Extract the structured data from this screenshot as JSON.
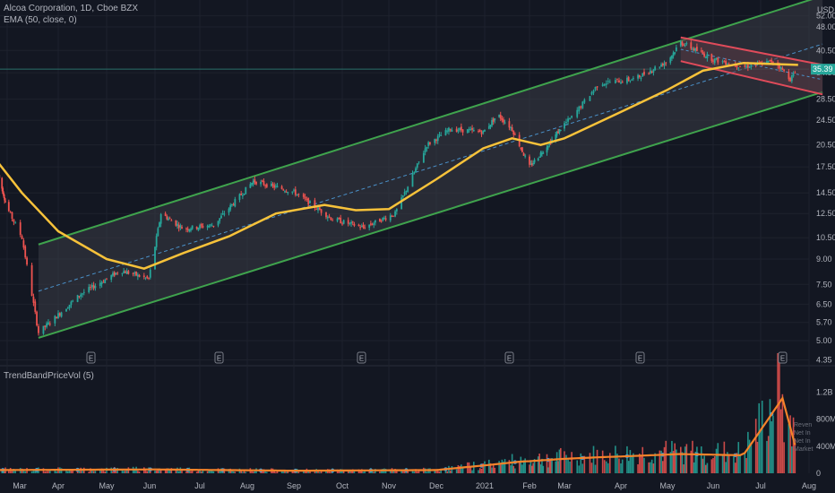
{
  "header": {
    "symbol_line": "Alcoa Corporation, 1D, Cboe BZX",
    "indicator_line": "EMA (50, close, 0)",
    "currency": "USD"
  },
  "lower_pane": {
    "title": "TrendBandPriceVol (5)",
    "right_labels": [
      "Reven",
      "Net In",
      "Net In",
      "Market"
    ]
  },
  "colors": {
    "background": "#131722",
    "grid": "#1e222d",
    "up": "#26a69a",
    "down": "#ef5350",
    "ema": "#f7c23a",
    "channel_edge": "#3fa34d",
    "channel_fill": "#3a3d46",
    "flag_edge": "#e04b5a",
    "midline": "#4a90c8",
    "axis_text": "#b2b5be",
    "volume_line": "#f5832a",
    "volume_marker": "#3a9ad9"
  },
  "chart_data": [
    {
      "type": "candlestick",
      "price_axis_labels": [
        "52.00",
        "48.00",
        "40.50",
        "34.50",
        "28.50",
        "24.50",
        "20.50",
        "17.50",
        "14.50",
        "12.50",
        "10.50",
        "9.00",
        "7.50",
        "6.50",
        "5.70",
        "5.00",
        "4.35"
      ],
      "price_axis_values": [
        52,
        48,
        40.5,
        34.5,
        28.5,
        24.5,
        20.5,
        17.5,
        14.5,
        12.5,
        10.5,
        9,
        7.5,
        6.5,
        5.7,
        5,
        4.35
      ],
      "scale": "log",
      "time_axis_labels": [
        "Mar",
        "Apr",
        "May",
        "Jun",
        "Jul",
        "Aug",
        "Sep",
        "Oct",
        "Nov",
        "Dec",
        "2021",
        "Feb",
        "Mar",
        "Apr",
        "May",
        "Jun",
        "Jul",
        "Aug"
      ],
      "last_price": "35.39",
      "earnings_markers": [
        "E",
        "E",
        "E",
        "E",
        "E",
        "E"
      ],
      "key_prices": [
        {
          "date": "2020-02-20",
          "price": 16.5
        },
        {
          "date": "2020-03-10",
          "price": 10.5
        },
        {
          "date": "2020-03-20",
          "price": 5.3
        },
        {
          "date": "2020-04-15",
          "price": 7.0
        },
        {
          "date": "2020-05-10",
          "price": 8.3
        },
        {
          "date": "2020-05-28",
          "price": 7.8
        },
        {
          "date": "2020-06-05",
          "price": 12.5
        },
        {
          "date": "2020-06-20",
          "price": 11.2
        },
        {
          "date": "2020-07-10",
          "price": 11.5
        },
        {
          "date": "2020-08-05",
          "price": 15.8
        },
        {
          "date": "2020-09-01",
          "price": 14.6
        },
        {
          "date": "2020-09-25",
          "price": 12.0
        },
        {
          "date": "2020-10-15",
          "price": 11.3
        },
        {
          "date": "2020-11-05",
          "price": 12.5
        },
        {
          "date": "2020-11-25",
          "price": 20.5
        },
        {
          "date": "2020-12-10",
          "price": 23.0
        },
        {
          "date": "2020-12-31",
          "price": 22.5
        },
        {
          "date": "2021-01-10",
          "price": 25.5
        },
        {
          "date": "2021-01-20",
          "price": 23.0
        },
        {
          "date": "2021-02-01",
          "price": 17.5
        },
        {
          "date": "2021-02-20",
          "price": 21.5
        },
        {
          "date": "2021-03-05",
          "price": 25.0
        },
        {
          "date": "2021-03-20",
          "price": 32.0
        },
        {
          "date": "2021-04-10",
          "price": 33.0
        },
        {
          "date": "2021-05-01",
          "price": 37.5
        },
        {
          "date": "2021-05-10",
          "price": 43.0
        },
        {
          "date": "2021-06-01",
          "price": 38.0
        },
        {
          "date": "2021-06-20",
          "price": 36.0
        },
        {
          "date": "2021-07-10",
          "price": 37.5
        },
        {
          "date": "2021-07-20",
          "price": 33.0
        },
        {
          "date": "2021-07-25",
          "price": 35.39
        }
      ],
      "ema_50": [
        {
          "date": "2020-02-20",
          "value": 18.0
        },
        {
          "date": "2020-03-10",
          "value": 14.5
        },
        {
          "date": "2020-04-01",
          "value": 11.0
        },
        {
          "date": "2020-05-01",
          "value": 9.0
        },
        {
          "date": "2020-05-25",
          "value": 8.4
        },
        {
          "date": "2020-06-20",
          "value": 9.4
        },
        {
          "date": "2020-07-20",
          "value": 10.6
        },
        {
          "date": "2020-08-20",
          "value": 12.5
        },
        {
          "date": "2020-09-20",
          "value": 13.3
        },
        {
          "date": "2020-10-10",
          "value": 12.8
        },
        {
          "date": "2020-11-01",
          "value": 12.9
        },
        {
          "date": "2020-12-01",
          "value": 16.0
        },
        {
          "date": "2020-12-31",
          "value": 20.0
        },
        {
          "date": "2021-01-20",
          "value": 21.5
        },
        {
          "date": "2021-02-10",
          "value": 20.5
        },
        {
          "date": "2021-03-01",
          "value": 21.5
        },
        {
          "date": "2021-04-01",
          "value": 26.0
        },
        {
          "date": "2021-05-01",
          "value": 30.5
        },
        {
          "date": "2021-05-25",
          "value": 35.0
        },
        {
          "date": "2021-06-20",
          "value": 37.0
        },
        {
          "date": "2021-07-25",
          "value": 36.5
        }
      ],
      "ascending_channel": {
        "upper": [
          {
            "date": "2020-03-20",
            "price": 10.0
          },
          {
            "date": "2021-08-10",
            "price": 60.0
          }
        ],
        "lower": [
          {
            "date": "2020-03-20",
            "price": 5.1
          },
          {
            "date": "2021-08-10",
            "price": 30.0
          }
        ]
      },
      "descending_flag": {
        "upper": [
          {
            "date": "2021-05-10",
            "price": 44.5
          },
          {
            "date": "2021-08-10",
            "price": 36.5
          }
        ],
        "lower": [
          {
            "date": "2021-05-10",
            "price": 37.5
          },
          {
            "date": "2021-08-10",
            "price": 29.5
          }
        ]
      }
    },
    {
      "type": "bar",
      "name": "volume",
      "axis_labels": [
        "1.2B",
        "800M",
        "400M",
        "0"
      ],
      "axis_values": [
        1200,
        800,
        400,
        0
      ],
      "units": "M",
      "key_volumes": [
        {
          "date": "2020-02-20",
          "value": 50
        },
        {
          "date": "2020-06-01",
          "value": 60
        },
        {
          "date": "2020-09-01",
          "value": 40
        },
        {
          "date": "2020-12-01",
          "value": 50
        },
        {
          "date": "2021-01-25",
          "value": 180
        },
        {
          "date": "2021-03-20",
          "value": 250
        },
        {
          "date": "2021-05-10",
          "value": 300
        },
        {
          "date": "2021-06-20",
          "value": 280
        },
        {
          "date": "2021-07-15",
          "value": 1170
        },
        {
          "date": "2021-07-25",
          "value": 260
        }
      ]
    }
  ]
}
